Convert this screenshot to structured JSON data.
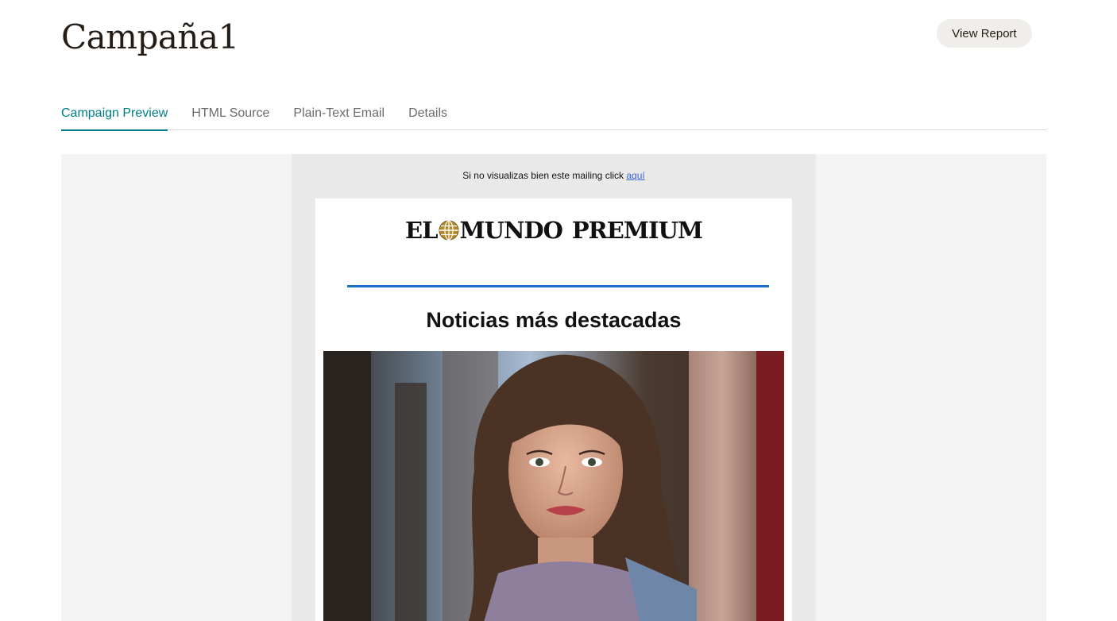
{
  "header": {
    "title": "Campaña1",
    "view_report_label": "View Report"
  },
  "tabs": [
    {
      "label": "Campaign Preview",
      "active": true
    },
    {
      "label": "HTML Source",
      "active": false
    },
    {
      "label": "Plain-Text Email",
      "active": false
    },
    {
      "label": "Details",
      "active": false
    }
  ],
  "email": {
    "preheader_text": "Si no visualizas bien este mailing click ",
    "preheader_link": "aquí",
    "logo": {
      "part1": "EL",
      "part2": "MUNDO",
      "part3": "PREMIUM"
    },
    "headline": "Noticias más destacadas",
    "accent_color": "#1a73c9",
    "photo_icon": "portrait-photo"
  },
  "colors": {
    "tab_active": "#007c89",
    "button_bg": "#efeeea",
    "preview_bg": "#f3f3f3"
  }
}
